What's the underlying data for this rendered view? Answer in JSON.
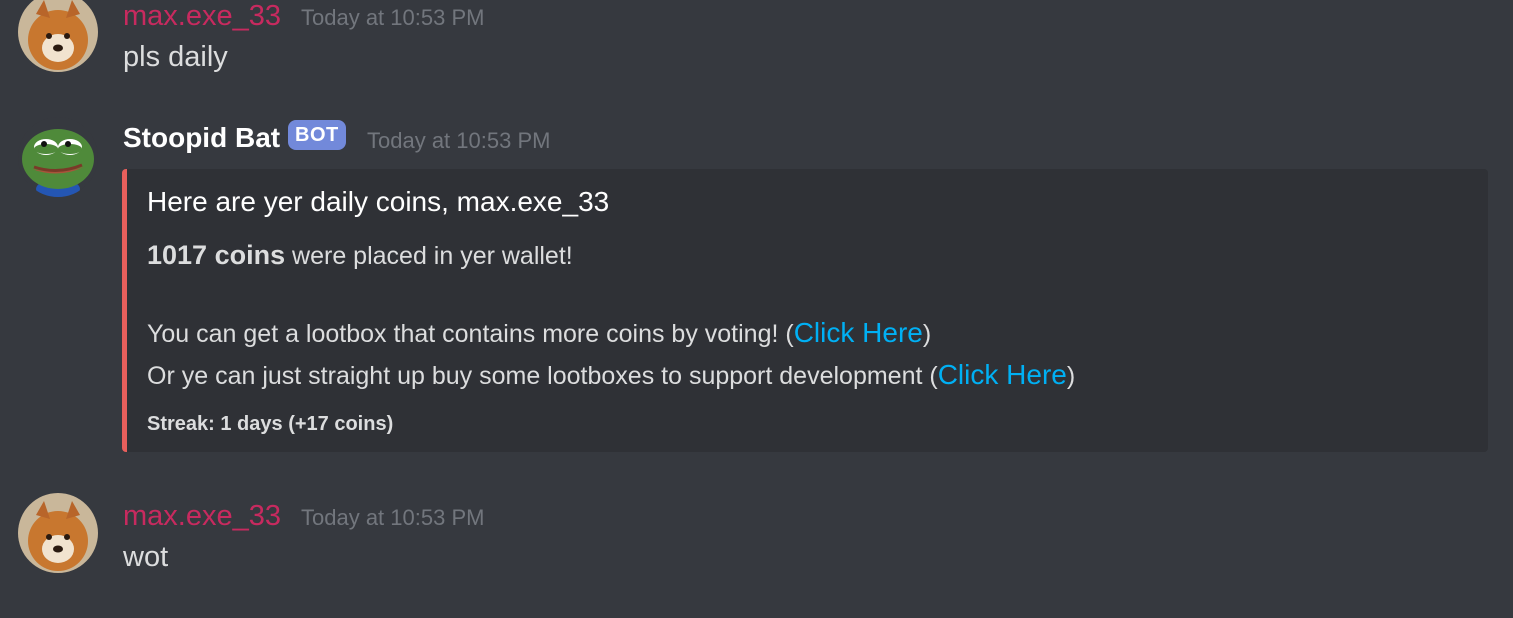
{
  "messages": [
    {
      "username": "max.exe_33",
      "timestamp": "Today at 10:53 PM",
      "text": "pls daily"
    },
    {
      "username": "Stoopid Bat",
      "bot_tag": "BOT",
      "timestamp": "Today at 10:53 PM",
      "embed": {
        "title": "Here are yer daily coins, max.exe_33",
        "coins_bold": "1017 coins",
        "coins_rest": " were placed in yer wallet!",
        "vote_text": "You can get a lootbox that contains more coins by voting! (",
        "vote_link": "Click Here",
        "vote_close": ")",
        "buy_text": "Or ye can just straight up buy some lootboxes to support development (",
        "buy_link": "Click Here",
        "buy_close": ")",
        "footer": "Streak: 1 days (+17 coins)",
        "accent_color": "#e85f5c"
      }
    },
    {
      "username": "max.exe_33",
      "timestamp": "Today at 10:53 PM",
      "text": "wot"
    }
  ],
  "colors": {
    "background": "#36393f",
    "user_name": "#c72a5f",
    "bot_tag": "#7289da",
    "link": "#00b0f4"
  }
}
